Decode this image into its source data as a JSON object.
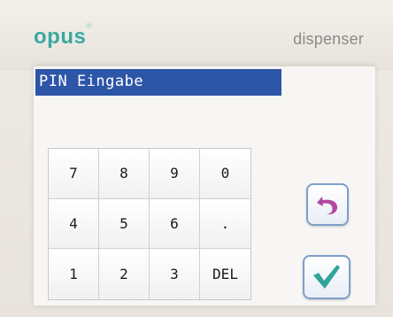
{
  "header": {
    "brand": "opus",
    "brand_mark": "®",
    "product": "dispenser"
  },
  "screen": {
    "title": "PIN Eingabe"
  },
  "keypad": {
    "keys": [
      "7",
      "8",
      "9",
      "0",
      "4",
      "5",
      "6",
      ".",
      "1",
      "2",
      "3",
      "DEL"
    ]
  },
  "actions": {
    "back_icon": "undo-arrow-icon",
    "confirm_icon": "checkmark-icon"
  },
  "colors": {
    "brand": "#3aa9a0",
    "title_bar": "#2d55a8",
    "back_arrow": "#b04aa0",
    "checkmark": "#2fa59a"
  }
}
